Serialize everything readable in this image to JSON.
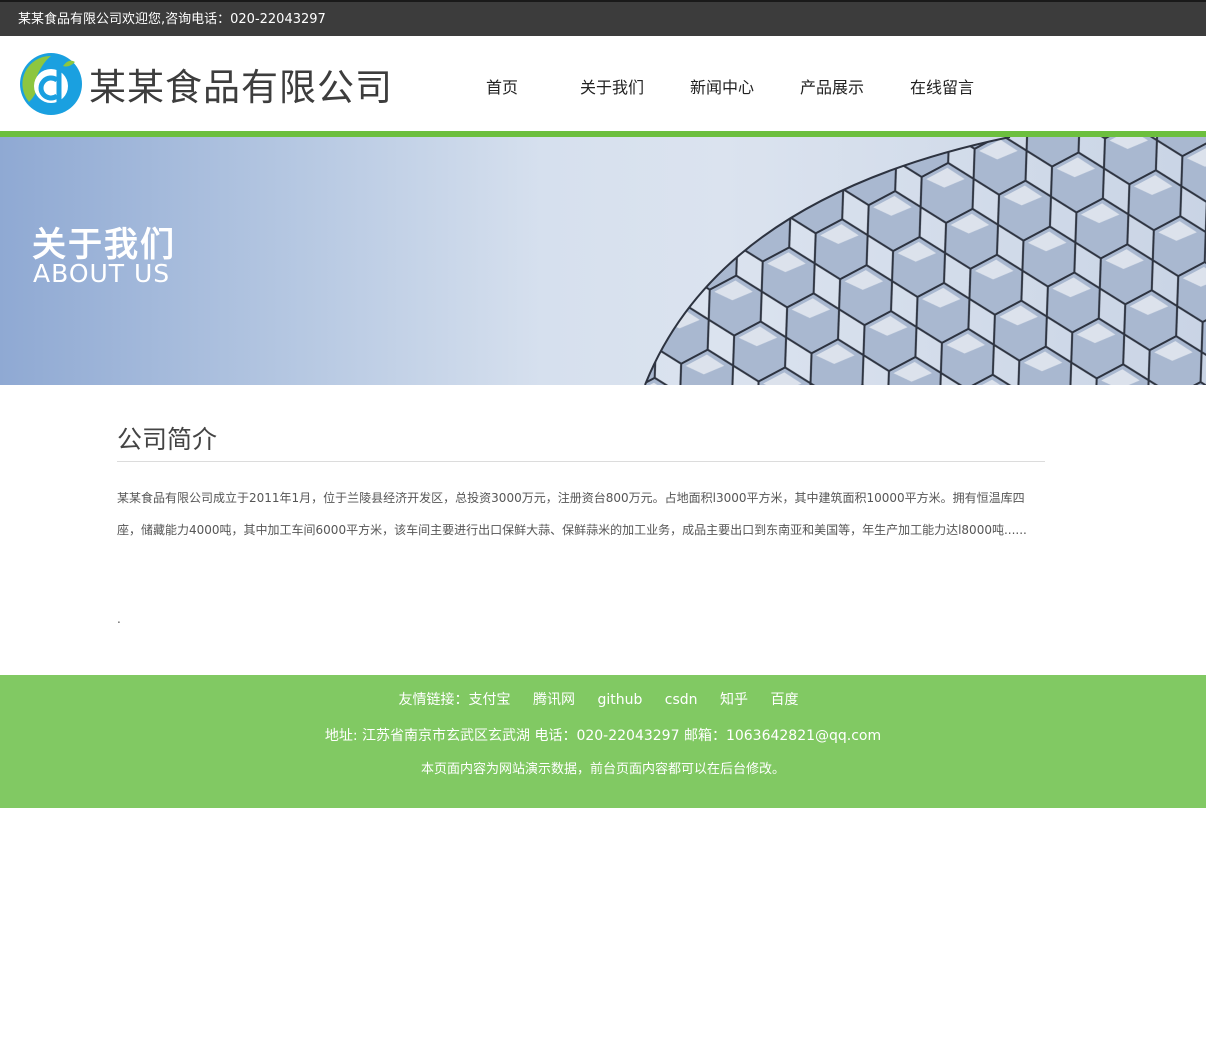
{
  "topbar": {
    "text": "某某食品有限公司欢迎您,咨询电话：020-22043297"
  },
  "header": {
    "logo_text": "某某食品有限公司",
    "nav": [
      {
        "label": "首页"
      },
      {
        "label": "关于我们"
      },
      {
        "label": "新闻中心"
      },
      {
        "label": "产品展示"
      },
      {
        "label": "在线留言"
      }
    ]
  },
  "banner": {
    "title": "关于我们",
    "subtitle": "ABOUT US"
  },
  "main": {
    "section_title": "公司简介",
    "paragraph": "某某食品有限公司成立于2011年1月，位于兰陵县经济开发区，总投资3000万元，注册资台800万元。占地面积l3000平方米，其中建筑面积10000平方米。拥有恒温库四座，储藏能力4000吨，其中加工车间6000平方米，该车间主要进行出口保鲜大蒜、保鲜蒜米的加工业务，成品主要出口到东南亚和美国等，年生产加工能力达l8000吨......",
    "trailing": "."
  },
  "footer": {
    "links_label": "友情链接：",
    "links": [
      "支付宝",
      "腾讯网",
      "github",
      "csdn",
      "知乎",
      "百度"
    ],
    "address": "地址: 江苏省南京市玄武区玄武湖 电话：020-22043297 邮箱：1063642821@qq.com",
    "note": "本页面内容为网站演示数据，前台页面内容都可以在后台修改。"
  },
  "colors": {
    "accent_green": "#6cbf3e",
    "footer_green": "#81c963",
    "topbar": "#3c3c3c"
  }
}
